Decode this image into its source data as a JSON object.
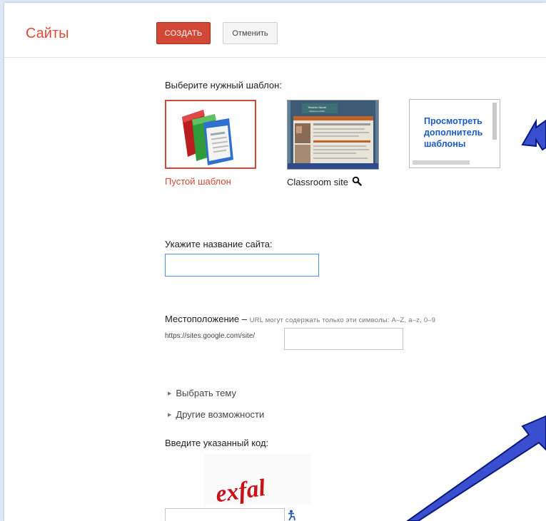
{
  "header": {
    "app_title": "Сайты",
    "create_label": "СОЗДАТЬ",
    "cancel_label": "Отменить"
  },
  "templates": {
    "heading": "Выберите нужный шаблон:",
    "items": [
      {
        "label": "Пустой шаблон",
        "selected": true
      },
      {
        "label": "Classroom site",
        "preview_icon": "magnifier-icon"
      }
    ],
    "more": "Просмотреть дополнитель шаблоны",
    "classroom_thumb": {
      "header_text": "Teacher Name",
      "sub_text": "Classroom 2010"
    }
  },
  "site_name": {
    "label": "Укажите название сайта:",
    "value": ""
  },
  "location": {
    "label": "Местоположение –",
    "hint": "URL могут содержать только эти символы: A–Z, a–z, 0–9",
    "prefix": "https://sites.google.com/site/",
    "value": ""
  },
  "options": {
    "theme": "Выбрать тему",
    "more": "Другие возможности"
  },
  "captcha": {
    "label": "Введите указанный код:",
    "image_text": "exfal",
    "value": "",
    "audio_icon": "accessibility-icon"
  },
  "colors": {
    "accent": "#d14836",
    "link": "#1a5bc4",
    "arrow": "#3a4fd0"
  }
}
